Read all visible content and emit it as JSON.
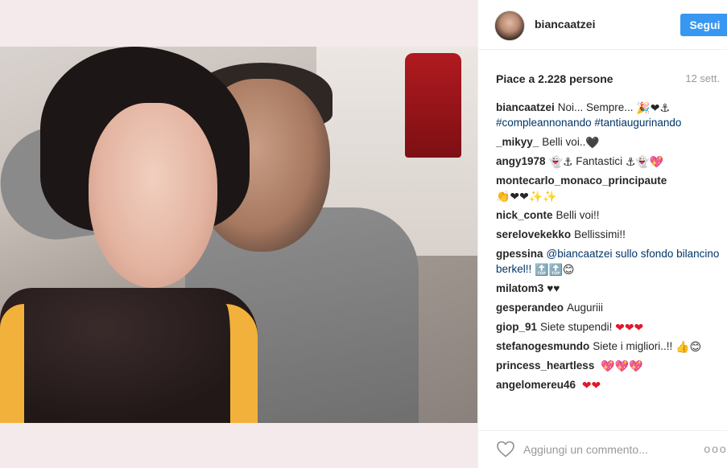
{
  "post": {
    "photo_alt": "",
    "username": "biancaatzei",
    "follow_label": "Segui",
    "likes_text": "Piace a 2.228 persone",
    "time_text": "12 sett."
  },
  "comments": [
    {
      "user": "biancaatzei",
      "text": "Noi... Sempre...",
      "emoji": "🎉❤⚓",
      "tags": "#compleannonando #tantiaugurinando"
    },
    {
      "user": "_mikyy_",
      "text": "Belli voi..",
      "emoji": "🖤"
    },
    {
      "user": "angy1978",
      "emoji_before": "👻⚓",
      "text": "Fantastici",
      "emoji": "⚓👻💖"
    },
    {
      "user": "montecarlo_monaco_principaute",
      "emoji": "👏❤❤✨✨"
    },
    {
      "user": "nick_conte",
      "text": "Belli voi!!"
    },
    {
      "user": "serelovekekko",
      "text": "Bellissimi!!"
    },
    {
      "user": "gpessina",
      "text": "@biancaatzei sullo sfondo bilancino berkel!!",
      "emoji": "🔝🔝😊"
    },
    {
      "user": "milatom3",
      "text": "♥♥"
    },
    {
      "user": "gesperandeo",
      "text": "Auguriii"
    },
    {
      "user": "giop_91",
      "text": "Siete stupendi!",
      "emoji": "❤❤❤"
    },
    {
      "user": "stefanogesmundo",
      "text": "Siete i migliori..!!",
      "emoji": "👍😊"
    },
    {
      "user": "princess_heartless",
      "emoji": "💖💖💖"
    },
    {
      "user": "angelomereu46",
      "emoji": "❤❤"
    }
  ],
  "footer": {
    "comment_placeholder": "Aggiungi un commento...",
    "more_label": "ooo"
  }
}
